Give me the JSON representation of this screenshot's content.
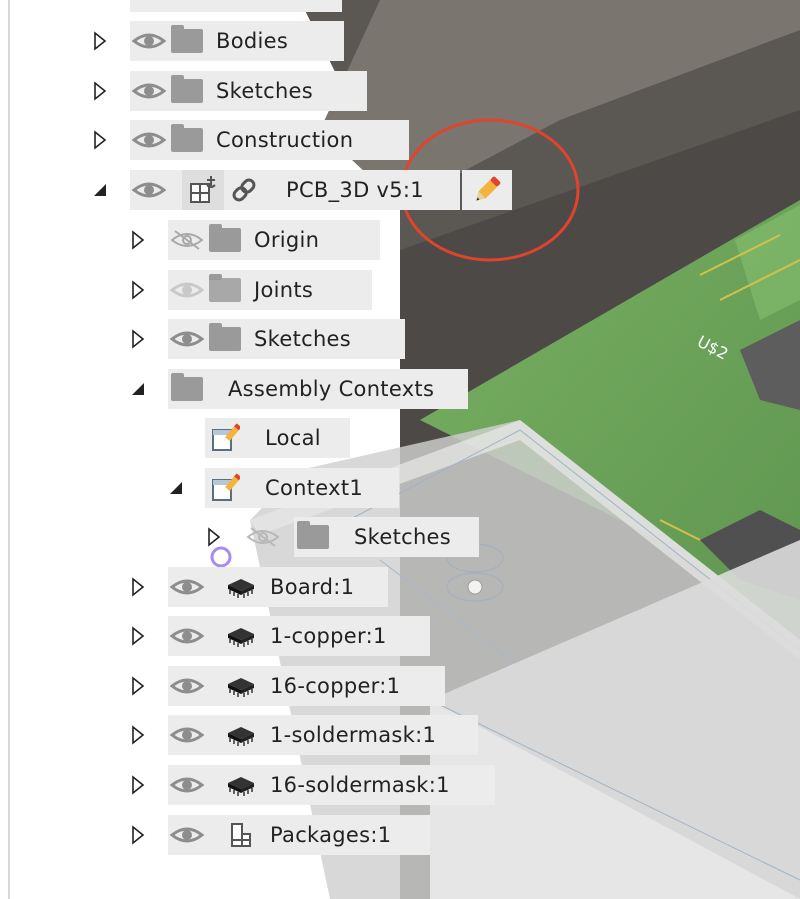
{
  "viewport": {
    "board_label": "U$2"
  },
  "browser": {
    "rows": [
      {
        "label": "Bodies",
        "expanded": false,
        "visibility": "visible",
        "icon": "folder-icon"
      },
      {
        "label": "Sketches",
        "expanded": false,
        "visibility": "visible",
        "icon": "folder-icon"
      },
      {
        "label": "Construction",
        "expanded": false,
        "visibility": "visible",
        "icon": "folder-icon"
      },
      {
        "label": "PCB_3D v5:1",
        "expanded": true,
        "visibility": "visible",
        "icon": "component-anchor-icon",
        "edit_icon": "pencil-icon",
        "link_icon": "link-icon"
      },
      {
        "label": "Origin",
        "expanded": false,
        "visibility": "hidden",
        "icon": "folder-icon"
      },
      {
        "label": "Joints",
        "expanded": false,
        "visibility": "dimmed",
        "icon": "folder-icon"
      },
      {
        "label": "Sketches",
        "expanded": false,
        "visibility": "visible",
        "icon": "folder-icon"
      },
      {
        "label": "Assembly Contexts",
        "expanded": true,
        "icon": "folder-icon"
      },
      {
        "label": "Local",
        "icon": "context-edit-icon"
      },
      {
        "label": "Context1",
        "expanded": true,
        "icon": "context-edit-icon"
      },
      {
        "label": "Sketches",
        "expanded": false,
        "visibility": "hidden",
        "icon": "folder-icon"
      },
      {
        "label": "Board:1",
        "expanded": false,
        "visibility": "visible",
        "icon": "chip-icon"
      },
      {
        "label": "1-copper:1",
        "expanded": false,
        "visibility": "visible",
        "icon": "chip-icon"
      },
      {
        "label": "16-copper:1",
        "expanded": false,
        "visibility": "visible",
        "icon": "chip-icon"
      },
      {
        "label": "1-soldermask:1",
        "expanded": false,
        "visibility": "visible",
        "icon": "chip-icon"
      },
      {
        "label": "16-soldermask:1",
        "expanded": false,
        "visibility": "visible",
        "icon": "chip-icon"
      },
      {
        "label": "Packages:1",
        "expanded": false,
        "visibility": "visible",
        "icon": "package-icon"
      }
    ]
  },
  "colors": {
    "row_bg": "#ececec",
    "board_green": "#6fa65a",
    "annotation_red": "#e0442c"
  }
}
